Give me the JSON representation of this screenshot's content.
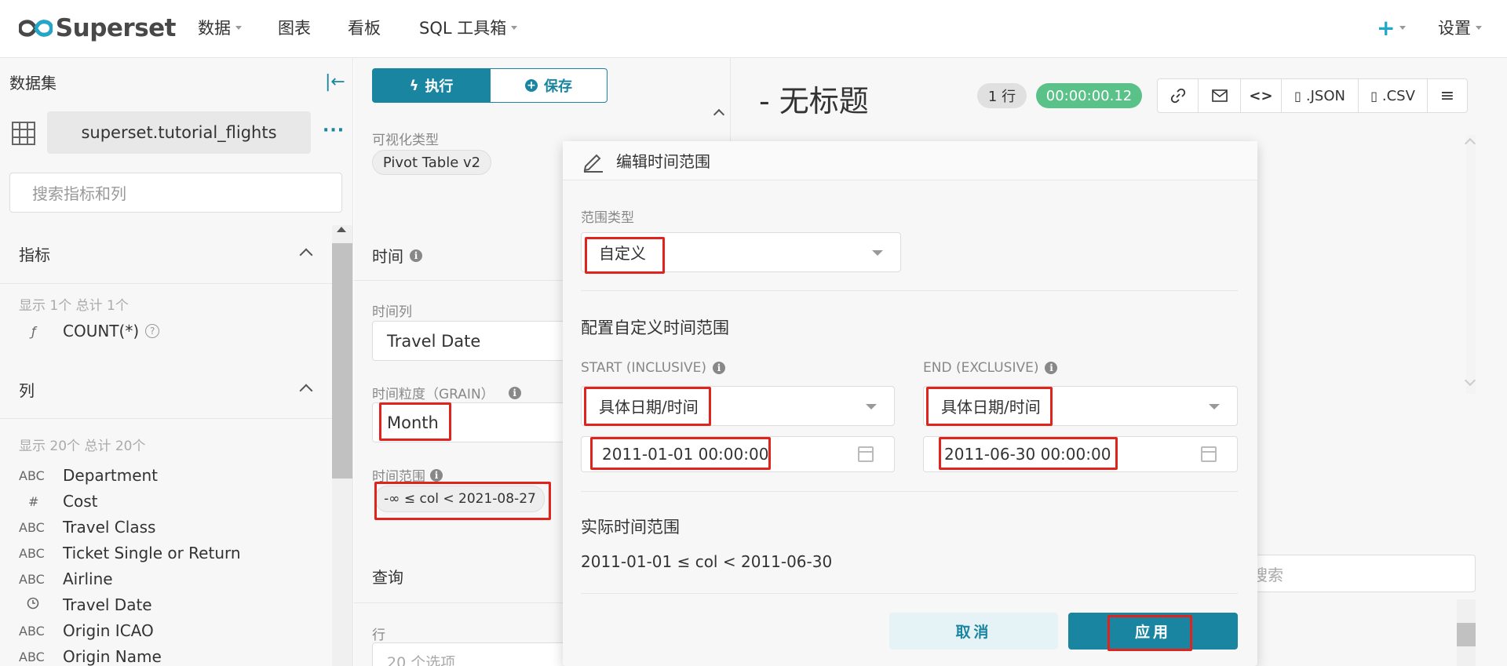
{
  "navbar": {
    "logo_text": "Superset",
    "items": [
      {
        "label": "数据",
        "has_caret": true
      },
      {
        "label": "图表",
        "has_caret": false
      },
      {
        "label": "看板",
        "has_caret": false
      },
      {
        "label": "SQL 工具箱",
        "has_caret": true
      }
    ],
    "settings_label": "设置"
  },
  "dataset_panel": {
    "title": "数据集",
    "dataset_name": "superset.tutorial_flights",
    "search_placeholder": "搜索指标和列",
    "metrics": {
      "title": "指标",
      "count_text": "显示 1个 总计 1个",
      "items": [
        {
          "type": "ƒ",
          "name": "COUNT(*)"
        }
      ]
    },
    "columns": {
      "title": "列",
      "count_text": "显示 20个 总计 20个",
      "items": [
        {
          "type": "ABC",
          "name": "Department"
        },
        {
          "type": "#",
          "name": "Cost"
        },
        {
          "type": "ABC",
          "name": "Travel Class"
        },
        {
          "type": "ABC",
          "name": "Ticket Single or Return"
        },
        {
          "type": "ABC",
          "name": "Airline"
        },
        {
          "type": "clock",
          "name": "Travel Date"
        },
        {
          "type": "ABC",
          "name": "Origin ICAO"
        },
        {
          "type": "ABC",
          "name": "Origin Name"
        }
      ]
    }
  },
  "control_panel": {
    "run_label": "执行",
    "save_label": "保存",
    "viz_type_label": "可视化类型",
    "viz_type_value": "Pivot Table v2",
    "time_section": "时间",
    "time_column_label": "时间列",
    "time_column_value": "Travel Date",
    "time_grain_label": "时间粒度（GRAIN）",
    "time_grain_value": "Month",
    "time_range_label": "时间范围",
    "time_range_value": "-∞ ≤ col < 2021-08-27",
    "query_section": "查询",
    "rows_label": "行",
    "rows_placeholder": "20 个选项"
  },
  "results_panel": {
    "title": "- 无标题",
    "row_count": "1 行",
    "duration": "00:00:00.12",
    "json_label": ".JSON",
    "csv_label": ".CSV",
    "search_placeholder": "搜索"
  },
  "modal": {
    "title": "编辑时间范围",
    "range_type_label": "范围类型",
    "range_type_value": "自定义",
    "custom_section": "配置自定义时间范围",
    "start_label": "START (INCLUSIVE)",
    "start_mode": "具体日期/时间",
    "start_value": "2011-01-01 00:00:00",
    "end_label": "END (EXCLUSIVE)",
    "end_mode": "具体日期/时间",
    "end_value": "2011-06-30 00:00:00",
    "actual_section": "实际时间范围",
    "actual_value": "2011-01-01 ≤ col < 2011-06-30",
    "cancel_label": "取消",
    "apply_label": "应用"
  },
  "colors": {
    "primary": "#1a85a0",
    "success": "#5ac189",
    "highlight": "#e0231c"
  }
}
